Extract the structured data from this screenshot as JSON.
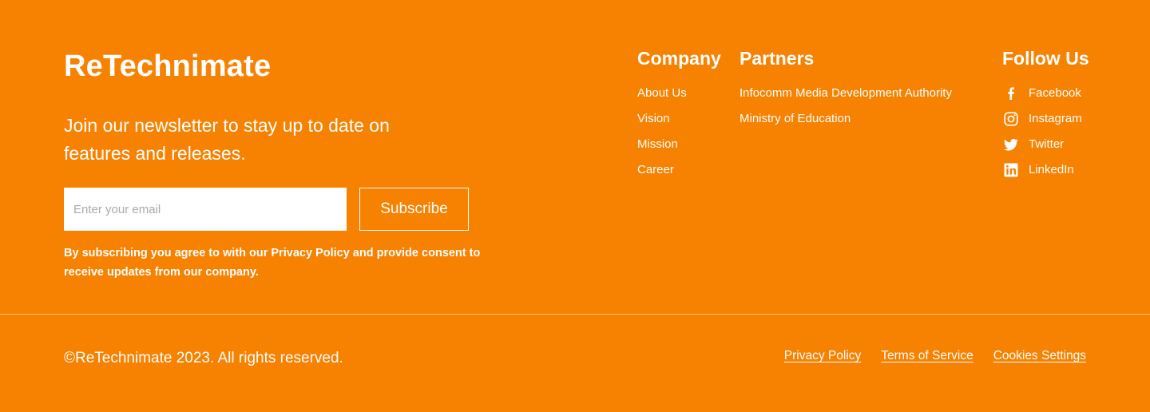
{
  "brand": {
    "name": "ReTechnimate"
  },
  "newsletter": {
    "tagline": "Join our newsletter to stay up to date on features and releases.",
    "email_placeholder": "Enter your email",
    "subscribe_label": "Subscribe",
    "disclaimer": "By subscribing you agree to with our Privacy Policy and provide consent to receive updates from our company."
  },
  "company": {
    "heading": "Company",
    "links": [
      "About Us",
      "Vision",
      "Mission",
      "Career"
    ]
  },
  "partners": {
    "heading": "Partners",
    "links": [
      "Infocomm Media Development Authority",
      "Ministry of Education"
    ]
  },
  "follow": {
    "heading": "Follow Us",
    "links": [
      {
        "label": "Facebook",
        "icon": "facebook-icon"
      },
      {
        "label": "Instagram",
        "icon": "instagram-icon"
      },
      {
        "label": "Twitter",
        "icon": "twitter-icon"
      },
      {
        "label": "LinkedIn",
        "icon": "linkedin-icon"
      }
    ]
  },
  "bottom": {
    "copyright": "©ReTechnimate 2023. All rights reserved.",
    "links": [
      "Privacy Policy",
      "Terms of Service",
      "Cookies Settings"
    ]
  },
  "colors": {
    "background": "#F78100",
    "text": "#FFFFFF"
  }
}
